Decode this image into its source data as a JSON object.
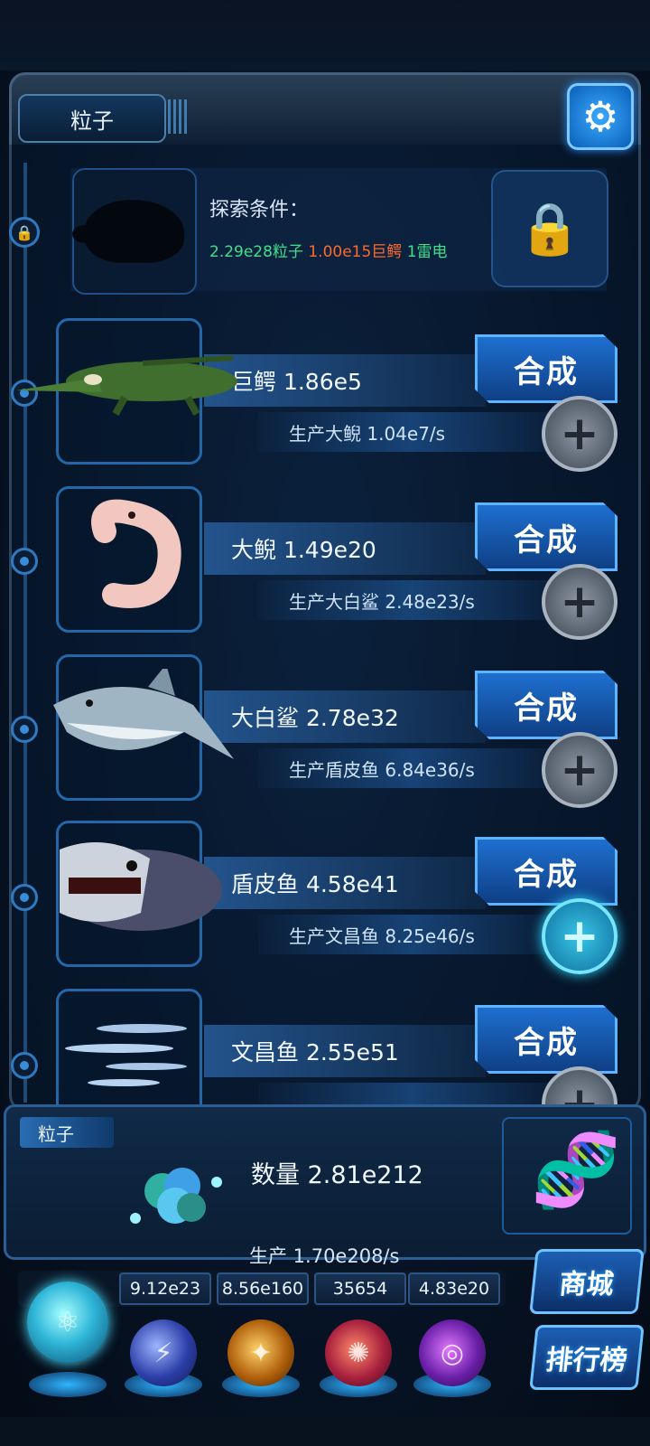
{
  "header": {
    "title": "粒子"
  },
  "locked_creature": {
    "explore_label": "探索条件：",
    "requirements": [
      {
        "text": "2.29e28粒子",
        "color": "#3fe08a"
      },
      {
        "text": "1.00e15巨鳄",
        "color": "#ff6a2a"
      },
      {
        "text": "1雷电",
        "color": "#3fe08a"
      }
    ]
  },
  "creatures": [
    {
      "name_label": "巨鳄 1.86e5",
      "production_label": "生产大鲵 1.04e7/s",
      "synth_label": "合成",
      "plus_active": false
    },
    {
      "name_label": "大鲵 1.49e20",
      "production_label": "生产大白鲨 2.48e23/s",
      "synth_label": "合成",
      "plus_active": false
    },
    {
      "name_label": "大白鲨 2.78e32",
      "production_label": "生产盾皮鱼 6.84e36/s",
      "synth_label": "合成",
      "plus_active": false
    },
    {
      "name_label": "盾皮鱼 4.58e41",
      "production_label": "生产文昌鱼 8.25e46/s",
      "synth_label": "合成",
      "plus_active": true
    },
    {
      "name_label": "文昌鱼 2.55e51",
      "production_label": "",
      "synth_label": "合成",
      "plus_active": false
    }
  ],
  "particle_panel": {
    "tag": "粒子",
    "quantity_label": "数量 2.81e212",
    "production_label": "生产 1.70e208/s"
  },
  "resources": [
    "9.12e23",
    "8.56e160",
    "35654",
    "4.83e20"
  ],
  "side_buttons": {
    "shop": "商城",
    "ranking": "排行榜"
  }
}
